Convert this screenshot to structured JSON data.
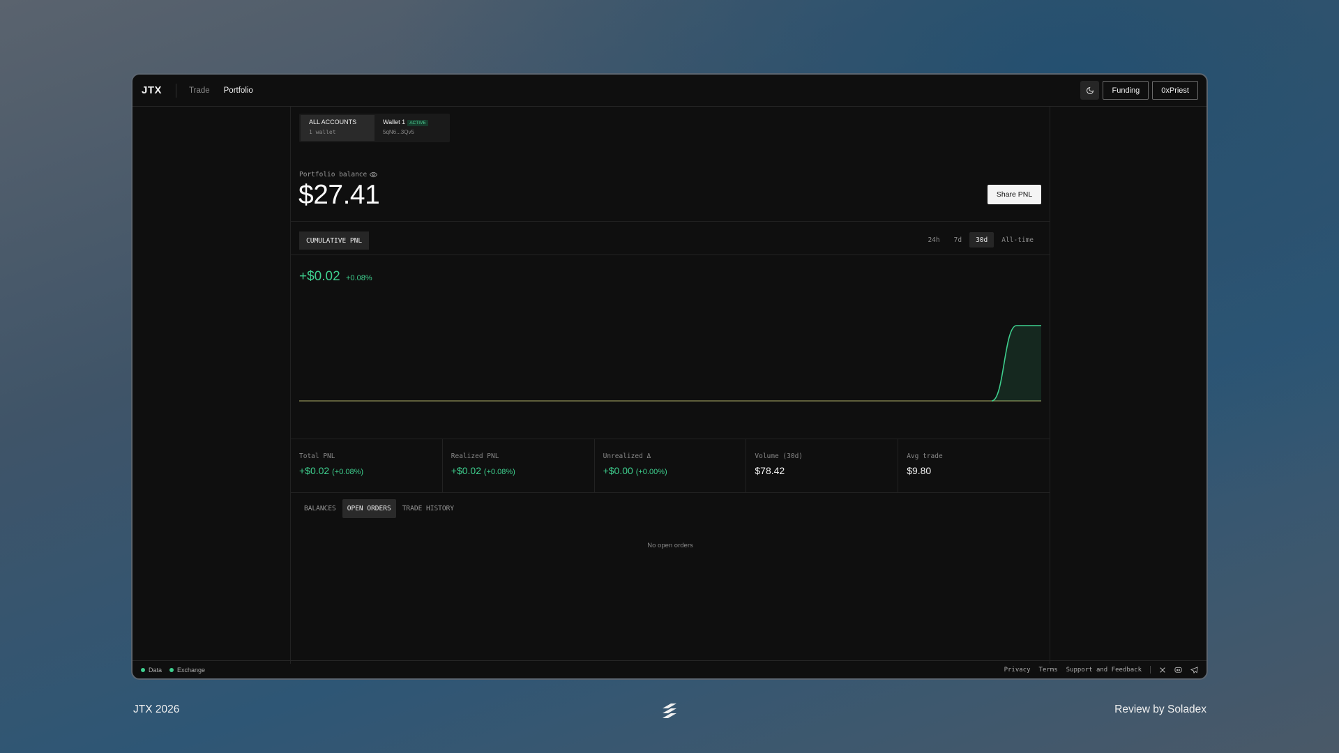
{
  "header": {
    "logo": "JTX",
    "nav": [
      {
        "label": "Trade"
      },
      {
        "label": "Portfolio"
      }
    ],
    "theme_icon": "moon-icon",
    "funding_label": "Funding",
    "account_label": "0xPriest"
  },
  "accounts": {
    "all": {
      "title": "ALL ACCOUNTS",
      "sub": "1 wallet"
    },
    "wallet": {
      "title": "Wallet 1",
      "badge": "ACTIVE",
      "sub": "5qN6...3Qv5"
    }
  },
  "portfolio": {
    "label": "Portfolio balance",
    "eye_icon": "eye-icon",
    "balance": "$27.41",
    "share_label": "Share PNL"
  },
  "pnl": {
    "tab_label": "CUMULATIVE PNL",
    "ranges": [
      "24h",
      "7d",
      "30d",
      "All-time"
    ],
    "selected_range": "30d",
    "value": "+$0.02",
    "pct": "+0.08%"
  },
  "chart_data": {
    "type": "area",
    "x": [
      0,
      1,
      2,
      3,
      4,
      5,
      6,
      7,
      8,
      9,
      10,
      11,
      12,
      13,
      14,
      15,
      16,
      17,
      18,
      19,
      20,
      21,
      22,
      23,
      24,
      25,
      26,
      27,
      28,
      29,
      30
    ],
    "series": [
      {
        "values": [
          0,
          0,
          0,
          0,
          0,
          0,
          0,
          0,
          0,
          0,
          0,
          0,
          0,
          0,
          0,
          0,
          0,
          0,
          0,
          0,
          0,
          0,
          0,
          0,
          0,
          0,
          0,
          0,
          0,
          0.02,
          0.02
        ]
      }
    ],
    "line_color": "#3ecf8e",
    "baseline_color": "#7a7a4a",
    "title": "",
    "xlabel": "",
    "ylabel": "",
    "grid": false
  },
  "stats": [
    {
      "label": "Total PNL",
      "value": "+$0.02",
      "sub": "(+0.08%)",
      "positive": true
    },
    {
      "label": "Realized PNL",
      "value": "+$0.02",
      "sub": "(+0.08%)",
      "positive": true
    },
    {
      "label": "Unrealized Δ",
      "value": "+$0.00",
      "sub": "(+0.00%)",
      "positive": true
    },
    {
      "label": "Volume (30d)",
      "value": "$78.42",
      "sub": "",
      "positive": false
    },
    {
      "label": "Avg trade",
      "value": "$9.80",
      "sub": "",
      "positive": false
    }
  ],
  "orders": {
    "tabs": [
      {
        "label": "BALANCES"
      },
      {
        "label": "OPEN ORDERS"
      },
      {
        "label": "TRADE HISTORY"
      }
    ],
    "selected": "OPEN ORDERS",
    "empty_text": "No open orders"
  },
  "footer": {
    "status": [
      {
        "label": "Data"
      },
      {
        "label": "Exchange"
      }
    ],
    "links": [
      {
        "label": "Privacy"
      },
      {
        "label": "Terms"
      },
      {
        "label": "Support and Feedback"
      }
    ],
    "social_icons": [
      "x-icon",
      "discord-icon",
      "telegram-icon"
    ]
  },
  "page_footer": {
    "left": "JTX 2026",
    "right": "Review by Soladex",
    "logo_icon": "soladex-logo-icon"
  },
  "colors": {
    "accent": "#3ecf8e",
    "background": "#0f0f0f"
  }
}
